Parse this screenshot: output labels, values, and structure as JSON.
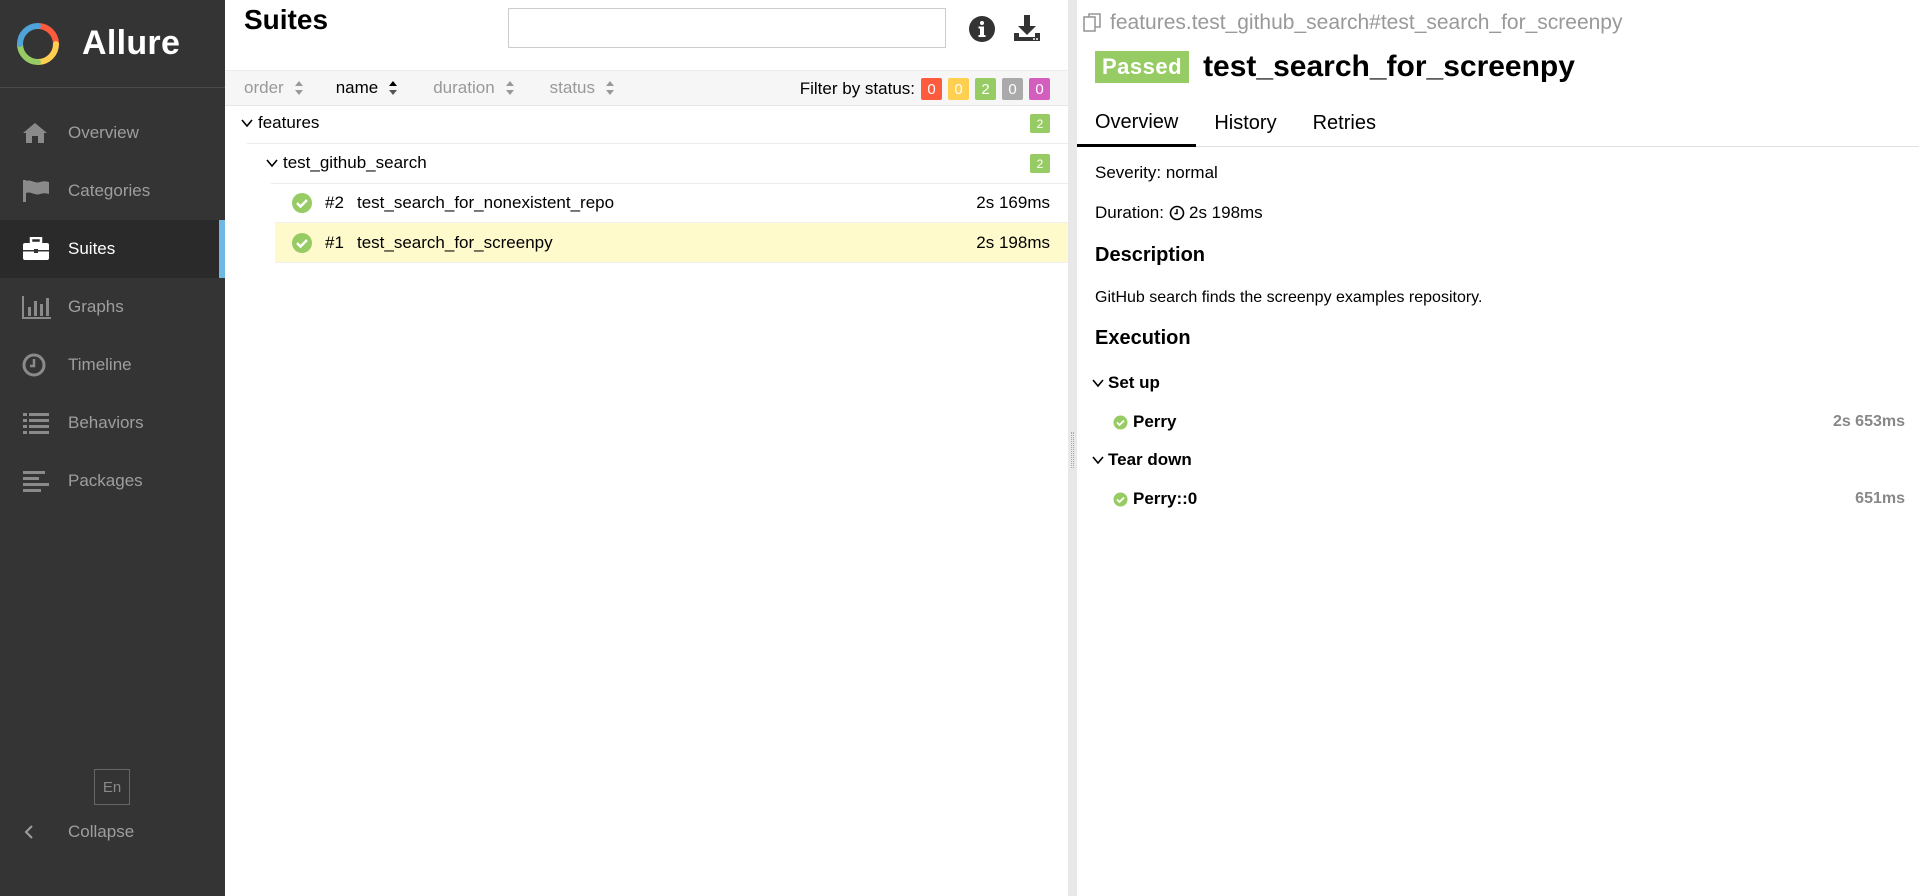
{
  "brand": {
    "name": "Allure"
  },
  "sidebar": {
    "items": [
      {
        "label": "Overview",
        "icon": "home-icon"
      },
      {
        "label": "Categories",
        "icon": "flag-icon"
      },
      {
        "label": "Suites",
        "icon": "briefcase-icon",
        "active": true
      },
      {
        "label": "Graphs",
        "icon": "bar-chart-icon"
      },
      {
        "label": "Timeline",
        "icon": "clock-icon"
      },
      {
        "label": "Behaviors",
        "icon": "list-icon"
      },
      {
        "label": "Packages",
        "icon": "align-left-icon"
      }
    ],
    "language": "En",
    "collapse_label": "Collapse"
  },
  "suites": {
    "title": "Suites",
    "search_value": "",
    "sort_columns": [
      {
        "label": "order"
      },
      {
        "label": "name",
        "active": true
      },
      {
        "label": "duration"
      },
      {
        "label": "status"
      }
    ],
    "filter_label": "Filter by status:",
    "filter_badges": [
      {
        "count": "0",
        "color": "#fd5a3e"
      },
      {
        "count": "0",
        "color": "#ffd050"
      },
      {
        "count": "2",
        "color": "#97cc64"
      },
      {
        "count": "0",
        "color": "#aaaaaa"
      },
      {
        "count": "0",
        "color": "#d35ebe"
      }
    ],
    "tree": {
      "root": {
        "label": "features",
        "count": "2"
      },
      "group": {
        "label": "test_github_search",
        "count": "2"
      },
      "tests": [
        {
          "num": "#2",
          "name": "test_search_for_nonexistent_repo",
          "duration": "2s 169ms"
        },
        {
          "num": "#1",
          "name": "test_search_for_screenpy",
          "duration": "2s 198ms",
          "selected": true
        }
      ]
    }
  },
  "detail": {
    "path": "features.test_github_search#test_search_for_screenpy",
    "status": "Passed",
    "title": "test_search_for_screenpy",
    "tabs": [
      "Overview",
      "History",
      "Retries"
    ],
    "severity_label": "Severity: normal",
    "duration_label": "Duration:",
    "duration_value": "2s 198ms",
    "description_title": "Description",
    "description_text": "GitHub search finds the screenpy examples repository.",
    "execution_title": "Execution",
    "setup_label": "Set up",
    "setup_step": {
      "name": "Perry",
      "duration": "2s 653ms"
    },
    "teardown_label": "Tear down",
    "teardown_step": {
      "name": "Perry::0",
      "duration": "651ms"
    }
  },
  "colors": {
    "passed": "#97cc64",
    "sidebar_bg": "#343434",
    "active_indicator": "#6fb8e4",
    "selected_row": "#fffacc"
  }
}
